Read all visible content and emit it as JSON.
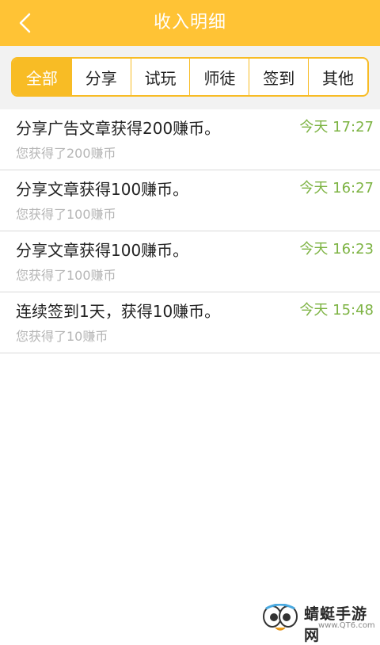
{
  "header": {
    "title": "收入明细"
  },
  "tabs": [
    {
      "label": "全部",
      "active": true
    },
    {
      "label": "分享",
      "active": false
    },
    {
      "label": "试玩",
      "active": false
    },
    {
      "label": "师徒",
      "active": false
    },
    {
      "label": "签到",
      "active": false
    },
    {
      "label": "其他",
      "active": false
    }
  ],
  "records": [
    {
      "title": "分享广告文章获得200赚币。",
      "subtitle": "您获得了200赚币",
      "time": "今天 17:27"
    },
    {
      "title": "分享文章获得100赚币。",
      "subtitle": "您获得了100赚币",
      "time": "今天 16:27"
    },
    {
      "title": "分享文章获得100赚币。",
      "subtitle": "您获得了100赚币",
      "time": "今天 16:23"
    },
    {
      "title": "连续签到1天，获得10赚币。",
      "subtitle": "您获得了10赚币",
      "time": "今天 15:48"
    }
  ],
  "watermark": {
    "name": "蜻蜓手游网",
    "url": "www.QT6.com"
  },
  "colors": {
    "header_bg": "#FFC335",
    "tab_accent": "#F8BC25",
    "time_green": "#7DB343",
    "subtitle_gray": "#b5b5b5"
  },
  "icons": {
    "back": "chevron-left-icon",
    "watermark_logo": "cartoon-eyes-logo"
  }
}
